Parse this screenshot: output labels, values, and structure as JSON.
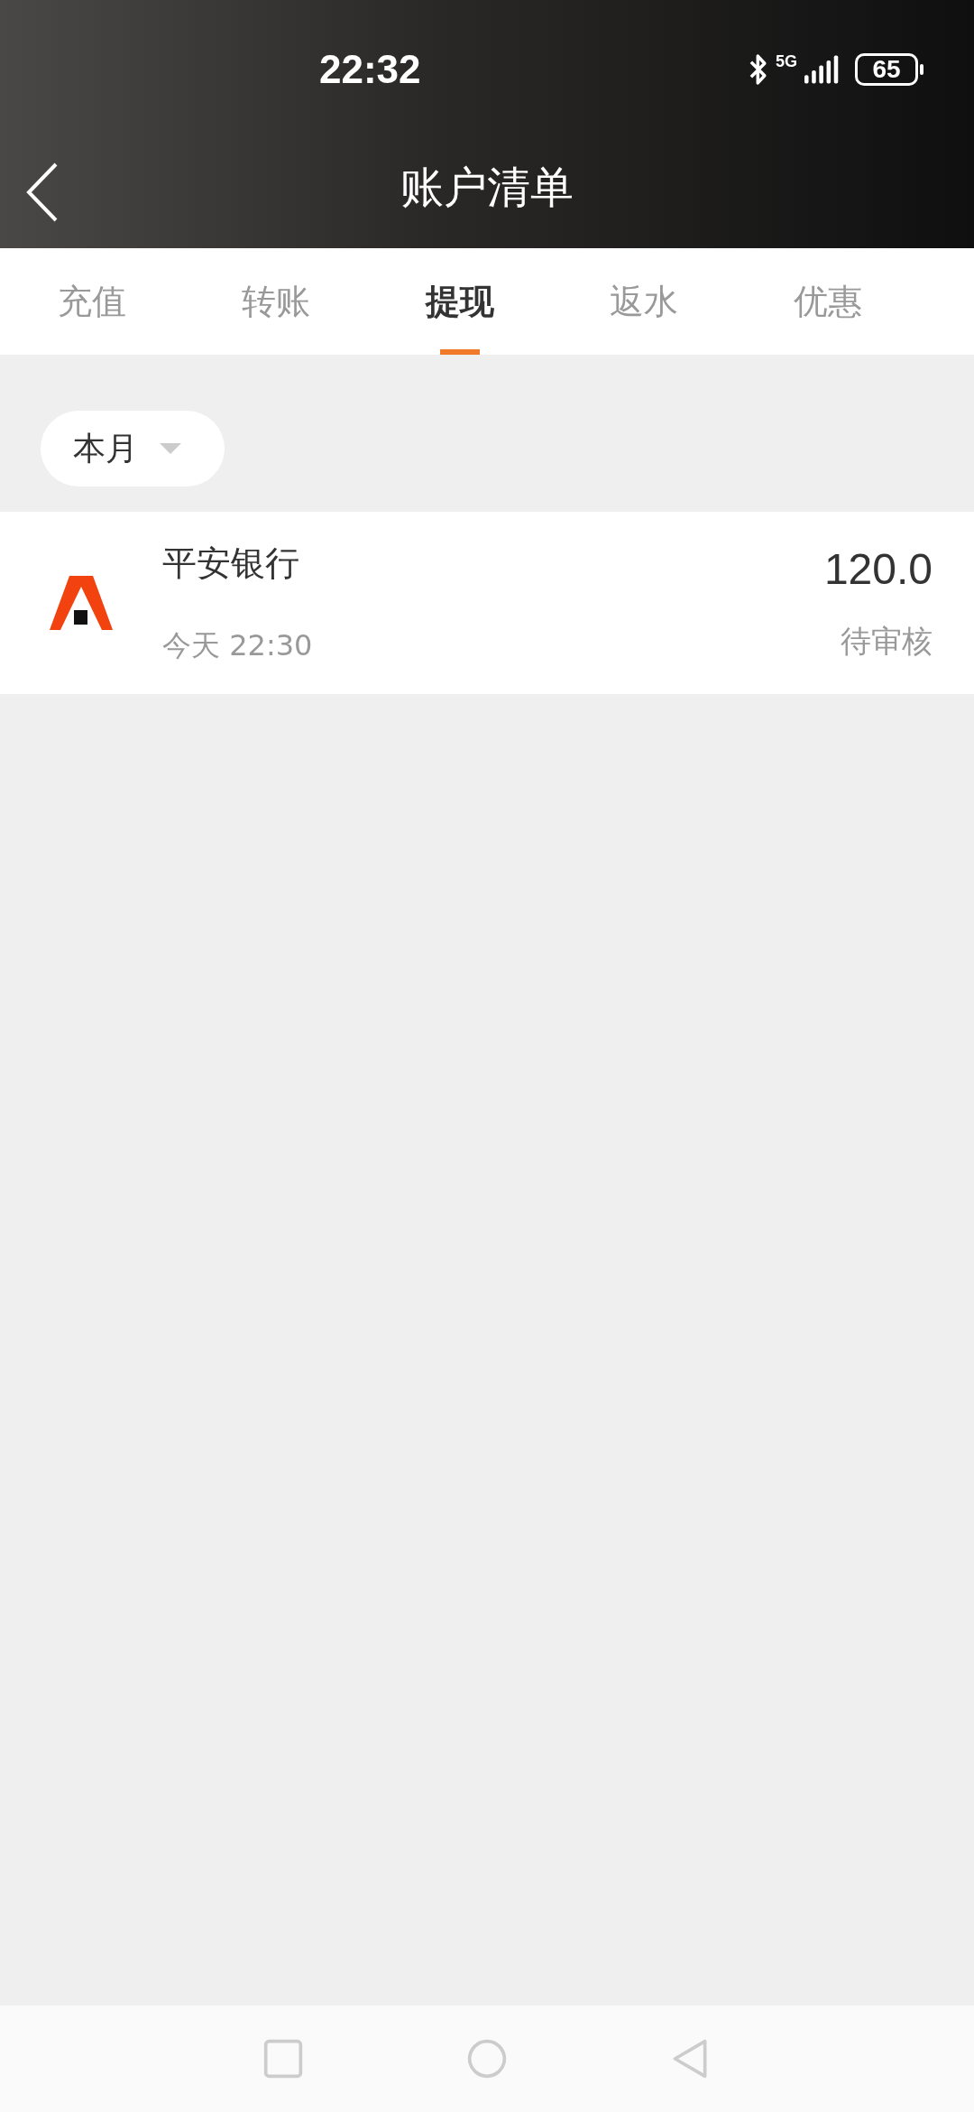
{
  "status_bar": {
    "time": "22:32",
    "network": "5G",
    "battery": "65"
  },
  "header": {
    "title": "账户清单"
  },
  "tabs": [
    {
      "label": "充值",
      "selected": false
    },
    {
      "label": "转账",
      "selected": false
    },
    {
      "label": "提现",
      "selected": true
    },
    {
      "label": "返水",
      "selected": false
    },
    {
      "label": "优惠",
      "selected": false
    }
  ],
  "filter": {
    "label": "本月"
  },
  "records": [
    {
      "name": "平安银行",
      "time": "今天 22:30",
      "amount": "120.0",
      "status": "待审核"
    }
  ]
}
